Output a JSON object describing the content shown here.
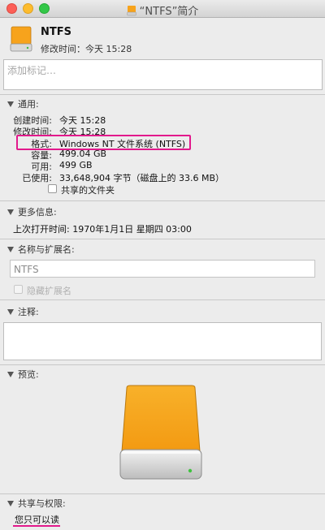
{
  "window": {
    "title": "“NTFS”简介"
  },
  "header": {
    "name": "NTFS",
    "modified": "修改时间：今天 15:28"
  },
  "tags": {
    "placeholder": "添加标记…"
  },
  "general": {
    "heading": "通用:",
    "created_label": "创建时间:",
    "created_value": "今天 15:28",
    "modified_label": "修改时间:",
    "modified_value": "今天 15:28",
    "format_label": "格式:",
    "format_value": "Windows NT 文件系统 (NTFS)",
    "capacity_label": "容量:",
    "capacity_value": "499.04 GB",
    "available_label": "可用:",
    "available_value": "499 GB",
    "used_label": "已使用:",
    "used_value": "33,648,904 字节（磁盘上的 33.6 MB）",
    "shared_folder_label": "共享的文件夹"
  },
  "more_info": {
    "heading": "更多信息:",
    "last_opened": "上次打开时间: 1970年1月1日 星期四 03:00"
  },
  "name_ext": {
    "heading": "名称与扩展名:",
    "name_value": "NTFS",
    "hide_ext_label": "隐藏扩展名"
  },
  "comments": {
    "heading": "注释:"
  },
  "preview": {
    "heading": "预览:"
  },
  "sharing": {
    "heading": "共享与权限:",
    "permission": "您只可以读"
  },
  "colors": {
    "highlight": "#e2198c",
    "drive_orange": "#f7a31c"
  }
}
